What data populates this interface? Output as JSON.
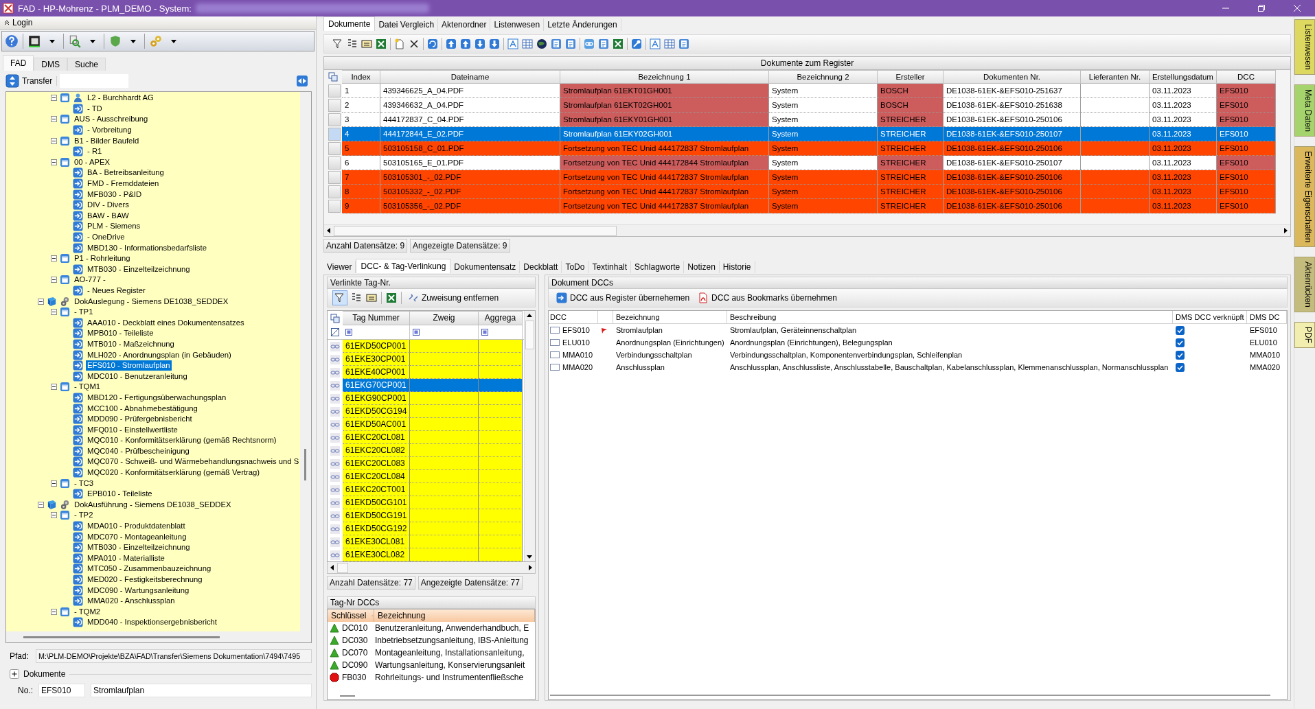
{
  "window": {
    "title": "FAD - HP-Mohrenz - PLM_DEMO - System:"
  },
  "login": {
    "label": "Login"
  },
  "left_tabs": [
    {
      "label": "FAD",
      "selected": true
    },
    {
      "label": "DMS",
      "selected": false
    },
    {
      "label": "Suche",
      "selected": false
    }
  ],
  "transfer": {
    "label": "Transfer"
  },
  "tree": {
    "items": [
      {
        "children": [
          {
            "label": "L2 - Burchhardt AG",
            "kind": "company",
            "expanded": true,
            "children": [
              {
                "label": "- TD",
                "kind": "leaf",
                "selected": false
              }
            ]
          },
          {
            "label": "AUS - Ausschreibung",
            "kind": "group",
            "expanded": true,
            "children": [
              {
                "label": "- Vorbreitung",
                "kind": "leaf",
                "selected": false
              }
            ]
          },
          {
            "label": "B1 - Bilder Baufeld",
            "kind": "group",
            "expanded": true,
            "children": [
              {
                "label": "- R1",
                "kind": "leaf",
                "selected": false
              }
            ]
          },
          {
            "label": "00 - APEX",
            "kind": "group",
            "expanded": true,
            "children": [
              {
                "label": "BA - Betreibsanleitung",
                "kind": "leaf",
                "selected": false
              },
              {
                "label": "FMD - Fremddateien",
                "kind": "leaf",
                "selected": false
              },
              {
                "label": "MFB030 - P&ID",
                "kind": "leaf",
                "selected": false
              },
              {
                "label": "DIV - Divers",
                "kind": "leaf",
                "selected": false
              },
              {
                "label": "BAW - BAW",
                "kind": "leaf",
                "selected": false
              },
              {
                "label": "PLM - Siemens",
                "kind": "leaf",
                "selected": false
              },
              {
                "label": "- OneDrive",
                "kind": "leaf",
                "selected": false
              },
              {
                "label": "MBD130 - Informationsbedarfsliste",
                "kind": "leaf",
                "selected": false
              }
            ]
          },
          {
            "label": "P1 - Rohrleitung",
            "kind": "group",
            "expanded": true,
            "children": [
              {
                "label": "MTB030 - Einzelteilzeichnung",
                "kind": "leaf",
                "selected": false
              }
            ]
          },
          {
            "label": "AO-777 -",
            "kind": "group",
            "expanded": true,
            "children": [
              {
                "label": "- Neues Register",
                "kind": "leaf",
                "selected": false
              }
            ]
          }
        ]
      },
      {
        "label": "DokAuslegung - Siemens DE1038_SEDDEX",
        "kind": "project",
        "expanded": true,
        "children": [
          {
            "label": "- TP1",
            "kind": "group",
            "expanded": true,
            "children": [
              {
                "label": "AAA010 - Deckblatt eines Dokumentensatzes",
                "kind": "leaf",
                "selected": false
              },
              {
                "label": "MPB010 - Teileliste",
                "kind": "leaf",
                "selected": false
              },
              {
                "label": "MTB010 - Maßzeichnung",
                "kind": "leaf",
                "selected": false
              },
              {
                "label": "MLH020 - Anordnungsplan (in Gebäuden)",
                "kind": "leaf",
                "selected": false
              },
              {
                "label": "EFS010 - Stromlaufplan",
                "kind": "leaf",
                "selected": true
              },
              {
                "label": "MDC010 - Benutzeranleitung",
                "kind": "leaf",
                "selected": false
              }
            ]
          },
          {
            "label": "- TQM1",
            "kind": "group",
            "expanded": true,
            "children": [
              {
                "label": "MBD120 - Fertigungsüberwachungsplan",
                "kind": "leaf",
                "selected": false
              },
              {
                "label": "MCC100 - Abnahmebestätigung",
                "kind": "leaf",
                "selected": false
              },
              {
                "label": "MDD090 - Prüfergebnisbericht",
                "kind": "leaf",
                "selected": false
              },
              {
                "label": "MFQ010 - Einstellwertliste",
                "kind": "leaf",
                "selected": false
              },
              {
                "label": "MQC010 - Konformitätserklärung  (gemäß Rechtsnorm)",
                "kind": "leaf",
                "selected": false
              },
              {
                "label": "MQC040 - Prüfbescheinigung",
                "kind": "leaf",
                "selected": false
              },
              {
                "label": "MQC070 - Schweiß- und Wärmebehandlungsnachweis und S",
                "kind": "leaf",
                "selected": false
              },
              {
                "label": "MQC020 - Konformitätserklärung (gemäß Vertrag)",
                "kind": "leaf",
                "selected": false
              }
            ]
          },
          {
            "label": "- TC3",
            "kind": "group",
            "expanded": true,
            "children": [
              {
                "label": "EPB010 - Teileliste",
                "kind": "leaf",
                "selected": false
              }
            ]
          }
        ]
      },
      {
        "label": "DokAusführung - Siemens DE1038_SEDDEX",
        "kind": "project",
        "expanded": true,
        "children": [
          {
            "label": "- TP2",
            "kind": "group",
            "expanded": true,
            "children": [
              {
                "label": "MDA010 - Produktdatenblatt",
                "kind": "leaf",
                "selected": false
              },
              {
                "label": "MDC070 - Montageanleitung",
                "kind": "leaf",
                "selected": false
              },
              {
                "label": "MTB030 - Einzelteilzeichnung",
                "kind": "leaf",
                "selected": false
              },
              {
                "label": "MPA010 - Materialliste",
                "kind": "leaf",
                "selected": false
              },
              {
                "label": "MTC050 - Zusammenbauzeichnung",
                "kind": "leaf",
                "selected": false
              },
              {
                "label": "MED020 - Festigkeitsberechnung",
                "kind": "leaf",
                "selected": false
              },
              {
                "label": "MDC090 - Wartungsanleitung",
                "kind": "leaf",
                "selected": false
              },
              {
                "label": "MMA020 - Anschlussplan",
                "kind": "leaf",
                "selected": false
              }
            ]
          },
          {
            "label": "- TQM2",
            "kind": "group",
            "expanded": true,
            "children": [
              {
                "label": "MDD040 - Inspektionsergebnisbericht",
                "kind": "leaf",
                "selected": false
              }
            ]
          }
        ]
      }
    ]
  },
  "path": {
    "label": "Pfad:",
    "value": "M:\\PLM-DEMO\\Projekte\\BZA\\FAD\\Transfer\\Siemens Dokumentation\\7494\\7495"
  },
  "documents_group": {
    "label": "Dokumente",
    "expanded": false
  },
  "number": {
    "label": "No.:",
    "value": "EFS010",
    "name": "Stromlaufplan"
  },
  "main_tabs": [
    {
      "label": "Dokumente",
      "selected": true
    },
    {
      "label": "Datei Vergleich",
      "selected": false
    },
    {
      "label": "Aktenordner",
      "selected": false
    },
    {
      "label": "Listenwesen",
      "selected": false
    },
    {
      "label": "Letzte Änderungen",
      "selected": false
    }
  ],
  "documents": {
    "title": "Dokumente zum Register",
    "columns": [
      "Index",
      "Dateiname",
      "Bezeichnung 1",
      "Bezeichnung 2",
      "Ersteller",
      "Dokumenten Nr.",
      "Lieferanten Nr.",
      "Erstellungsdatum",
      "DCC"
    ],
    "rows": [
      {
        "index": "1",
        "file": "439346625_A_04.PDF",
        "bez1": "Stromlaufplan 61EKT01GH001",
        "bez2": "System",
        "author": "BOSCH",
        "doc_no": "DE1038-61EK-&EFS010-251637",
        "date": "03.11.2023",
        "dcc": "EFS010",
        "kind": "partial",
        "selected": false
      },
      {
        "index": "2",
        "file": "439346632_A_04.PDF",
        "bez1": "Stromlaufplan 61EKT02GH001",
        "bez2": "System",
        "author": "BOSCH",
        "doc_no": "DE1038-61EK-&EFS010-251638",
        "date": "03.11.2023",
        "dcc": "EFS010",
        "kind": "partial",
        "selected": false
      },
      {
        "index": "3",
        "file": "444172837_C_04.PDF",
        "bez1": "Stromlaufplan 61EKY01GH001",
        "bez2": "System",
        "author": "STREICHER",
        "doc_no": "DE1038-61EK-&EFS010-250106",
        "date": "03.11.2023",
        "dcc": "EFS010",
        "kind": "partial",
        "selected": false
      },
      {
        "index": "4",
        "file": "444172844_E_02.PDF",
        "bez1": "Stromlaufplan 61EKY02GH001",
        "bez2": "System",
        "author": "STREICHER",
        "doc_no": "DE1038-61EK-&EFS010-250107",
        "date": "03.11.2023",
        "dcc": "EFS010",
        "selected": true
      },
      {
        "index": "5",
        "file": "503105158_C_01.PDF",
        "bez1": "Fortsetzung von TEC Unid 444172837 Stromlaufplan",
        "bez2": "System",
        "author": "STREICHER",
        "doc_no": "DE1038-61EK-&EFS010-250106",
        "date": "03.11.2023",
        "dcc": "EFS010",
        "kind": "error",
        "selected": false
      },
      {
        "index": "6",
        "file": "503105165_E_01.PDF",
        "bez1": "Fortsetzung von TEC Unid 444172844 Stromlaufplan",
        "bez2": "System",
        "author": "STREICHER",
        "doc_no": "DE1038-61EK-&EFS010-250107",
        "date": "03.11.2023",
        "dcc": "EFS010",
        "kind": "partial",
        "selected": false
      },
      {
        "index": "7",
        "file": "503105301_-_02.PDF",
        "bez1": "Fortsetzung von TEC Unid 444172837 Stromlaufplan",
        "bez2": "System",
        "author": "STREICHER",
        "doc_no": "DE1038-61EK-&EFS010-250106",
        "date": "03.11.2023",
        "dcc": "EFS010",
        "kind": "error",
        "selected": false
      },
      {
        "index": "8",
        "file": "503105332_-_02.PDF",
        "bez1": "Fortsetzung von TEC Unid 444172837 Stromlaufplan",
        "bez2": "System",
        "author": "STREICHER",
        "doc_no": "DE1038-61EK-&EFS010-250106",
        "date": "03.11.2023",
        "dcc": "EFS010",
        "kind": "error",
        "selected": false
      },
      {
        "index": "9",
        "file": "503105356_-_02.PDF",
        "bez1": "Fortsetzung von TEC Unid 444172837 Stromlaufplan",
        "bez2": "System",
        "author": "STREICHER",
        "doc_no": "DE1038-61EK-&EFS010-250106",
        "date": "03.11.2023",
        "dcc": "EFS010",
        "kind": "error",
        "selected": false
      }
    ],
    "record_counts": [
      "Anzahl Datensätze: 9",
      "Angezeigte Datensätze: 9"
    ]
  },
  "detail_tabs": [
    {
      "label": "Viewer",
      "selected": false
    },
    {
      "label": "DCC- & Tag-Verlinkung",
      "selected": true
    },
    {
      "label": "Dokumentensatz",
      "selected": false
    },
    {
      "label": "Deckblatt",
      "selected": false
    },
    {
      "label": "ToDo",
      "selected": false
    },
    {
      "label": "Textinhalt",
      "selected": false
    },
    {
      "label": "Schlagworte",
      "selected": false
    },
    {
      "label": "Notizen",
      "selected": false
    },
    {
      "label": "Historie",
      "selected": false
    }
  ],
  "linked_tags": {
    "title": "Verlinkte Tag-Nr.",
    "remove_button": "Zuweisung entfernen",
    "columns": [
      "Tag Nummer",
      "Zweig",
      "Aggrega"
    ],
    "rows": [
      {
        "tag": "61EKD50CP001",
        "selected": false
      },
      {
        "tag": "61EKE30CP001",
        "selected": false
      },
      {
        "tag": "61EKE40CP001",
        "selected": false
      },
      {
        "tag": "61EKG70CP001",
        "selected": true
      },
      {
        "tag": "61EKG90CP001",
        "selected": false
      },
      {
        "tag": "61EKD50CG194",
        "selected": false
      },
      {
        "tag": "61EKD50AC001",
        "selected": false
      },
      {
        "tag": "61EKC20CL081",
        "selected": false
      },
      {
        "tag": "61EKC20CL082",
        "selected": false
      },
      {
        "tag": "61EKC20CL083",
        "selected": false
      },
      {
        "tag": "61EKC20CL084",
        "selected": false
      },
      {
        "tag": "61EKC20CT001",
        "selected": false
      },
      {
        "tag": "61EKD50CG101",
        "selected": false
      },
      {
        "tag": "61EKD50CG191",
        "selected": false
      },
      {
        "tag": "61EKD50CG192",
        "selected": false
      },
      {
        "tag": "61EKE30CL081",
        "selected": false
      },
      {
        "tag": "61EKE30CL082",
        "selected": false
      }
    ],
    "record_counts": [
      "Anzahl Datensätze: 77",
      "Angezeigte Datensätze: 77"
    ]
  },
  "tag_dccs": {
    "title": "Tag-Nr DCCs",
    "columns": [
      "Schlüssel",
      "Bezeichnung"
    ],
    "rows": [
      {
        "key": "DC010",
        "label": "Benutzeranleitung, Anwenderhandbuch, E",
        "kind": "ok"
      },
      {
        "key": "DC030",
        "label": "Inbetriebsetzungsanleitung, IBS-Anleitung",
        "kind": "ok"
      },
      {
        "key": "DC070",
        "label": "Montageanleitung, Installationsanleitung,",
        "kind": "ok"
      },
      {
        "key": "DC090",
        "label": "Wartungsanleitung, Konservierungsanleit",
        "kind": "ok"
      },
      {
        "key": "FB030",
        "label": "Rohrleitungs- und Instrumentenfließsche",
        "kind": "missing"
      }
    ]
  },
  "document_dccs": {
    "title": "Dokument DCCs",
    "buttons": [
      "DCC aus Register übernehemen",
      "DCC aus Bookmarks übernehmen"
    ],
    "columns": [
      "DCC",
      "Bezeichnung",
      "Beschreibung",
      "DMS DCC verknüpft",
      "DMS DC"
    ],
    "rows": [
      {
        "dcc": "EFS010",
        "flagged": true,
        "label": "Stromlaufplan",
        "description": "Stromlaufplan, Geräteinnenschaltplan",
        "linked": true,
        "dms_dcc": "EFS010"
      },
      {
        "dcc": "ELU010",
        "flagged": false,
        "label": "Anordnungsplan (Einrichtungen)",
        "description": "Anordnungsplan (Einrichtungen), Belegungsplan",
        "linked": true,
        "dms_dcc": "ELU010"
      },
      {
        "dcc": "MMA010",
        "flagged": false,
        "label": "Verbindungsschaltplan",
        "description": "Verbindungsschaltplan, Komponentenverbindungsplan, Schleifenplan",
        "linked": true,
        "dms_dcc": "MMA010"
      },
      {
        "dcc": "MMA020",
        "flagged": false,
        "label": "Anschlussplan",
        "description": "Anschlussplan, Anschlussliste, Anschlusstabelle, Bauschaltplan, Kabelanschlussplan, Klemmenanschlussplan, Normanschlussplan",
        "linked": true,
        "dms_dcc": "MMA020"
      }
    ]
  },
  "side_tabs": [
    {
      "label": "Listenwesen",
      "color": "#dcd860"
    },
    {
      "label": "Meta Daten",
      "color": "#a6d46c"
    },
    {
      "label": "Erweiterte Eigenschaften",
      "color": "#dcb85c"
    },
    {
      "label": "Aktenrücken",
      "color": "#c4bc7c"
    },
    {
      "label": "PDF",
      "color": "#f2eeb0"
    }
  ]
}
